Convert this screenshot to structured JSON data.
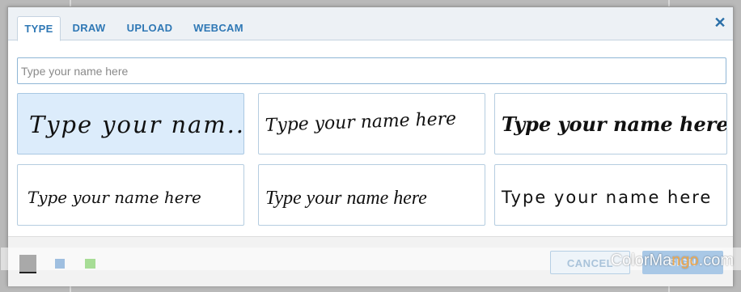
{
  "tabs": [
    {
      "label": "TYPE",
      "active": true
    },
    {
      "label": "DRAW",
      "active": false
    },
    {
      "label": "UPLOAD",
      "active": false
    },
    {
      "label": "WEBCAM",
      "active": false
    }
  ],
  "close_icon": "close-icon",
  "input": {
    "value": "",
    "placeholder": "Type your name here"
  },
  "signature_options": [
    {
      "text": "Type your nam...",
      "selected": true
    },
    {
      "text": "Type your name here",
      "selected": false
    },
    {
      "text": "Type your name here",
      "selected": false
    },
    {
      "text": "Type your name here",
      "selected": false
    },
    {
      "text": "Type your name here",
      "selected": false
    },
    {
      "text": "Type your name here",
      "selected": false
    }
  ],
  "colors": {
    "swatches": [
      {
        "name": "black",
        "hex": "#222222",
        "selected": true
      },
      {
        "name": "blue",
        "hex": "#9fbfe0",
        "selected": false
      },
      {
        "name": "green",
        "hex": "#a7dd96",
        "selected": false
      }
    ],
    "accent": "#2f78b5"
  },
  "buttons": {
    "cancel": "CANCEL",
    "sign": "SIGN"
  },
  "watermark": {
    "part1": "ColorMa",
    "part2": "ngo",
    "part3": ".com"
  }
}
